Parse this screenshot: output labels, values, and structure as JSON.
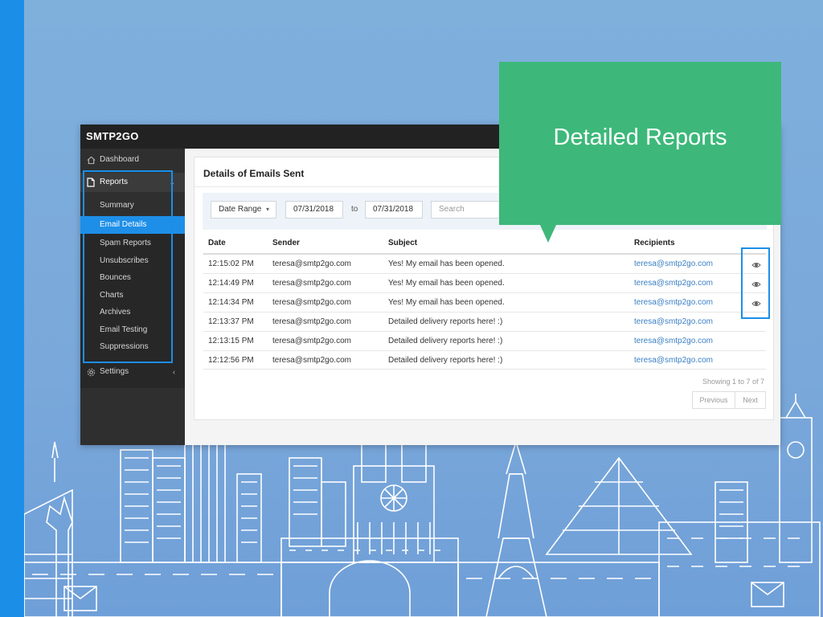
{
  "brand": {
    "logo": "SMTP2GO"
  },
  "callout": {
    "text": "Detailed Reports"
  },
  "sidebar": {
    "dashboard": "Dashboard",
    "reports": "Reports",
    "settings": "Settings",
    "items": [
      "Summary",
      "Email Details",
      "Spam Reports",
      "Unsubscribes",
      "Bounces",
      "Charts",
      "Archives",
      "Email Testing",
      "Suppressions"
    ]
  },
  "main": {
    "title": "Details of Emails Sent",
    "filters": {
      "date_range_label": "Date Range",
      "from_date": "07/31/2018",
      "to_label": "to",
      "to_date": "07/31/2018",
      "search_placeholder": "Search"
    },
    "columns": {
      "date": "Date",
      "sender": "Sender",
      "subject": "Subject",
      "recipients": "Recipients"
    },
    "rows": [
      {
        "date": "12:15:02 PM",
        "sender": "teresa@smtp2go.com",
        "subject": "Yes! My email has been opened.",
        "recipient": "teresa@smtp2go.com"
      },
      {
        "date": "12:14:49 PM",
        "sender": "teresa@smtp2go.com",
        "subject": "Yes! My email has been opened.",
        "recipient": "teresa@smtp2go.com"
      },
      {
        "date": "12:14:34 PM",
        "sender": "teresa@smtp2go.com",
        "subject": "Yes! My email has been opened.",
        "recipient": "teresa@smtp2go.com"
      },
      {
        "date": "12:13:37 PM",
        "sender": "teresa@smtp2go.com",
        "subject": "Detailed delivery reports here! :)",
        "recipient": "teresa@smtp2go.com"
      },
      {
        "date": "12:13:15 PM",
        "sender": "teresa@smtp2go.com",
        "subject": "Detailed delivery reports here! :)",
        "recipient": "teresa@smtp2go.com"
      },
      {
        "date": "12:12:56 PM",
        "sender": "teresa@smtp2go.com",
        "subject": "Detailed delivery reports here! :)",
        "recipient": "teresa@smtp2go.com"
      }
    ],
    "showing": "Showing 1 to 7 of 7",
    "pagination": {
      "previous": "Previous",
      "next": "Next"
    }
  },
  "colors": {
    "accent": "#1b8fe8",
    "callout": "#3db87a",
    "sidebar": "#2f2f2f",
    "link": "#3b7fc4"
  },
  "icons": [
    "home-icon",
    "file-icon",
    "chevron-down-icon",
    "gear-icon",
    "chevron-left-icon",
    "caret-down-icon",
    "eye-icon"
  ]
}
